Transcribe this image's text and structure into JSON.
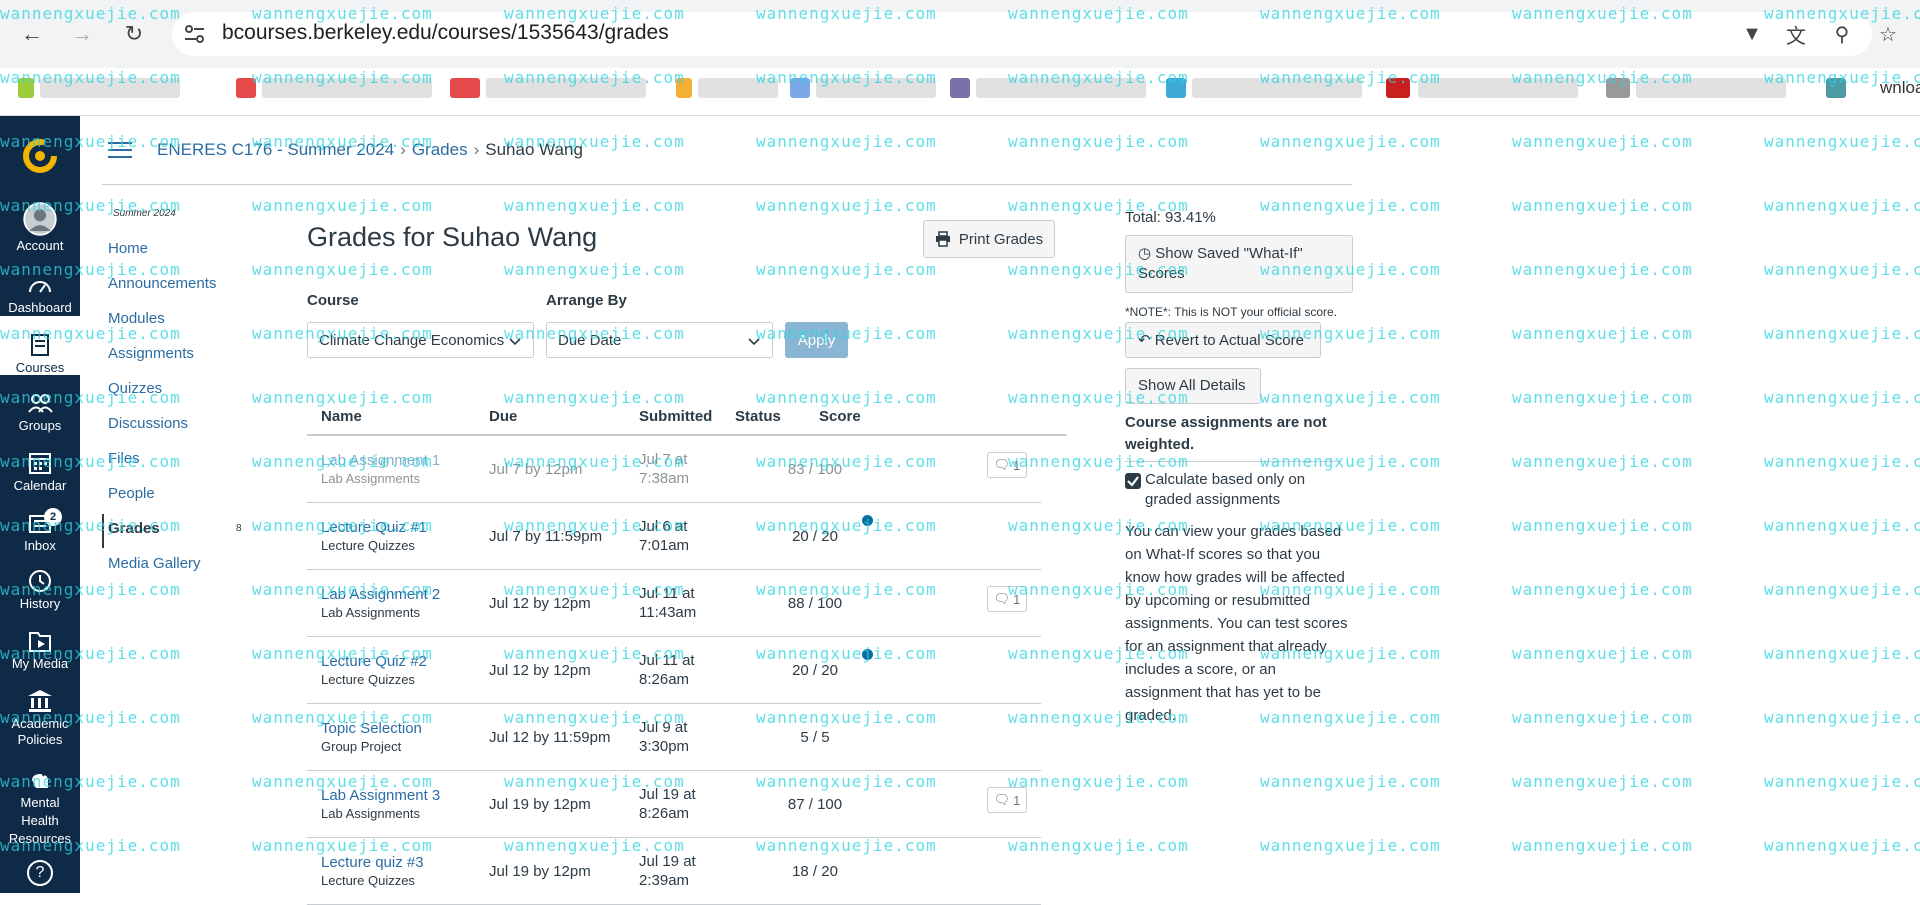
{
  "browser": {
    "url": "bcourses.berkeley.edu/courses/1535643/grades",
    "bookmark_partial": "wnloa"
  },
  "global_nav": {
    "items": [
      {
        "label": "Account",
        "icon": "account-icon"
      },
      {
        "label": "Dashboard",
        "icon": "dashboard-icon"
      },
      {
        "label": "Courses",
        "icon": "courses-icon"
      },
      {
        "label": "Groups",
        "icon": "groups-icon"
      },
      {
        "label": "Calendar",
        "icon": "calendar-icon"
      },
      {
        "label": "Inbox",
        "icon": "inbox-icon",
        "badge": "2"
      },
      {
        "label": "History",
        "icon": "history-icon"
      },
      {
        "label": "My Media",
        "icon": "my-media-icon"
      },
      {
        "label": "Academic Policies",
        "icon": "academic-policies-icon"
      },
      {
        "label": "Mental Health Resources",
        "icon": "mental-health-icon"
      },
      {
        "label": "?",
        "icon": "help-icon"
      }
    ],
    "active_color": "#0f2a47"
  },
  "breadcrumb": {
    "course": "ENERES C176 - Summer 2024",
    "section": "Grades",
    "current": "Suhao Wang"
  },
  "course_nav": {
    "term": "Summer 2024",
    "items": [
      "Home",
      "Announcements",
      "Modules",
      "Assignments",
      "Quizzes",
      "Discussions",
      "Files",
      "People",
      "Grades",
      "Media Gallery"
    ],
    "active": "Grades",
    "grades_count": "8"
  },
  "main": {
    "title": "Grades for Suhao Wang",
    "print_label": "Print Grades",
    "course_label": "Course",
    "course_value": "Climate Change Economics",
    "arrange_label": "Arrange By",
    "arrange_value": "Due Date",
    "apply_label": "Apply"
  },
  "table": {
    "headers": [
      "Name",
      "Due",
      "Submitted",
      "Status",
      "Score"
    ],
    "rows": [
      {
        "name": "Lab Assignment 1",
        "group": "Lab Assignments",
        "due": "Jul 7 by 12pm",
        "submitted_1": "Jul 7 at",
        "submitted_2": "7:38am",
        "score": "83 / 100",
        "comments": "1",
        "muted": true,
        "new": false
      },
      {
        "name": "Lecture Quiz #1",
        "group": "Lecture Quizzes",
        "due": "Jul 7 by 11:59pm",
        "submitted_1": "Jul 6 at",
        "submitted_2": "7:01am",
        "score": "20 / 20",
        "comments": "",
        "muted": false,
        "new": true
      },
      {
        "name": "Lab Assignment 2",
        "group": "Lab Assignments",
        "due": "Jul 12 by 12pm",
        "submitted_1": "Jul 11 at",
        "submitted_2": "11:43am",
        "score": "88 / 100",
        "comments": "1",
        "muted": false,
        "new": false
      },
      {
        "name": "Lecture Quiz #2",
        "group": "Lecture Quizzes",
        "due": "Jul 12 by 12pm",
        "submitted_1": "Jul 11 at",
        "submitted_2": "8:26am",
        "score": "20 / 20",
        "comments": "",
        "muted": false,
        "new": true
      },
      {
        "name": "Topic Selection",
        "group": "Group Project",
        "due": "Jul 12 by 11:59pm",
        "submitted_1": "Jul 9 at",
        "submitted_2": "3:30pm",
        "score": "5 / 5",
        "comments": "",
        "muted": false,
        "new": false
      },
      {
        "name": "Lab Assignment 3",
        "group": "Lab Assignments",
        "due": "Jul 19 by 12pm",
        "submitted_1": "Jul 19 at",
        "submitted_2": "8:26am",
        "score": "87 / 100",
        "comments": "1",
        "muted": false,
        "new": false
      },
      {
        "name": "Lecture quiz #3",
        "group": "Lecture Quizzes",
        "due": "Jul 19 by 12pm",
        "submitted_1": "Jul 19 at",
        "submitted_2": "2:39am",
        "score": "18 / 20",
        "comments": "",
        "muted": false,
        "new": false
      }
    ]
  },
  "sidebar": {
    "total": "Total: 93.41%",
    "show_saved": "Show Saved \"What-If\" Scores",
    "note": "*NOTE*: This is NOT your official score.",
    "revert": "Revert to Actual Score",
    "show_all": "Show All Details",
    "weighted_note": "Course assignments are not weighted.",
    "calc_label": "Calculate based only on graded assignments",
    "calc_checked": true,
    "whatif_para": "You can view your grades based on What-If scores so that you know how grades will be affected by upcoming or resubmitted assignments. You can test scores for an assignment that already includes a score, or an assignment that has yet to be graded."
  },
  "watermark": "wannengxuejie.com",
  "colors": {
    "link": "#2d6ca2",
    "text": "#2d3b45",
    "nav_bg": "#0f2a47",
    "apply": "#8ab6d3",
    "watermark": "#2dd3e0"
  }
}
